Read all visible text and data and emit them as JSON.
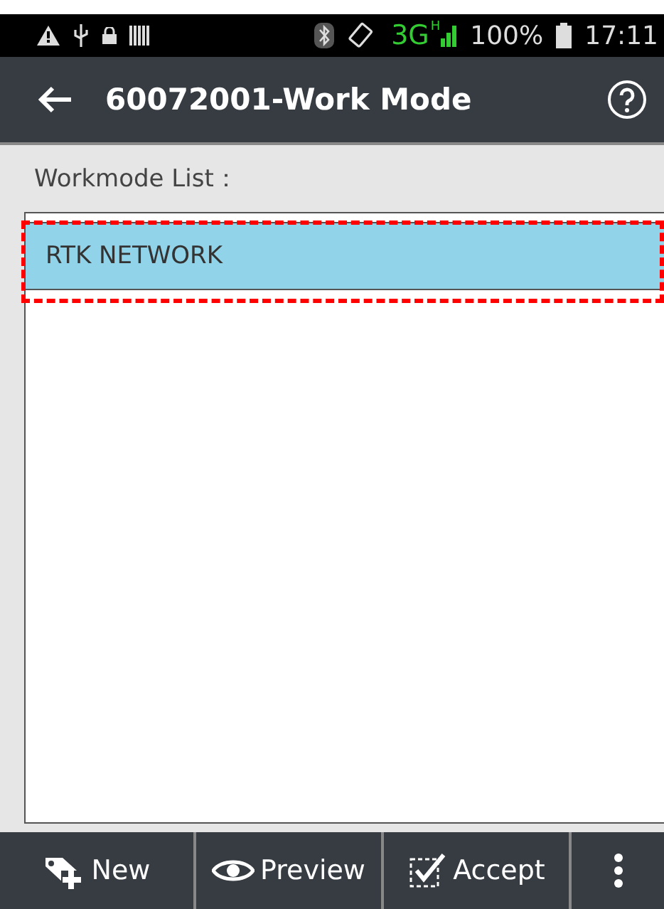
{
  "status_bar": {
    "network": "3G",
    "network_sub": "H",
    "battery": "100%",
    "time": "17:11"
  },
  "title_bar": {
    "title": "60072001-Work Mode"
  },
  "list_label": "Workmode List：",
  "items": [
    {
      "label": "RTK NETWORK",
      "selected": true,
      "highlighted": true
    }
  ],
  "toolbar": [
    {
      "kind": "new",
      "label": "New"
    },
    {
      "kind": "preview",
      "label": "Preview"
    },
    {
      "kind": "accept",
      "label": "Accept"
    },
    {
      "kind": "more"
    }
  ]
}
